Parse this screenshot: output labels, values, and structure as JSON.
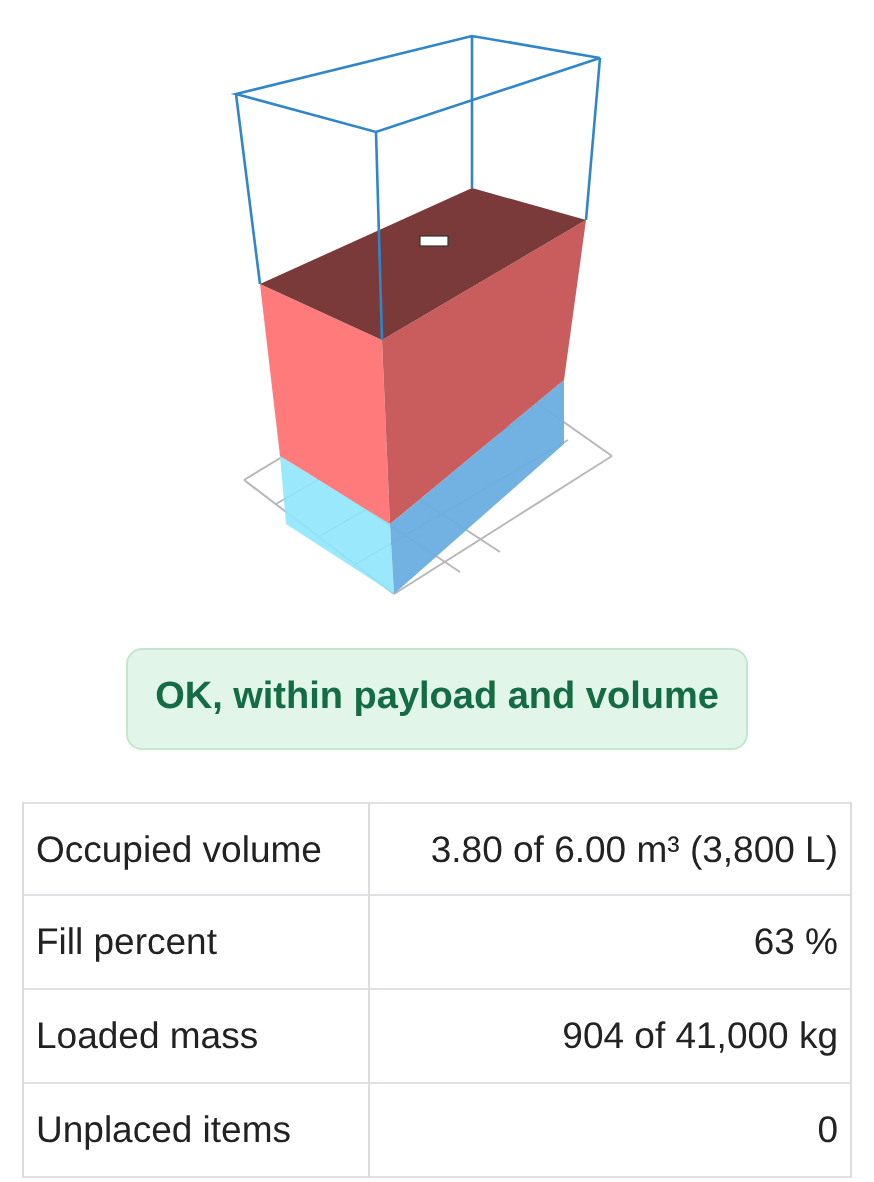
{
  "status": {
    "kind": "success",
    "text": "OK, within payload and volume"
  },
  "stats": [
    {
      "label": "Occupied volume",
      "value": "3.80 of 6.00 m³ (3,800 L)"
    },
    {
      "label": "Fill percent",
      "value": "63 %"
    },
    {
      "label": "Loaded mass",
      "value": "904 of 41,000 kg"
    },
    {
      "label": "Unplaced items",
      "value": "0"
    }
  ]
}
